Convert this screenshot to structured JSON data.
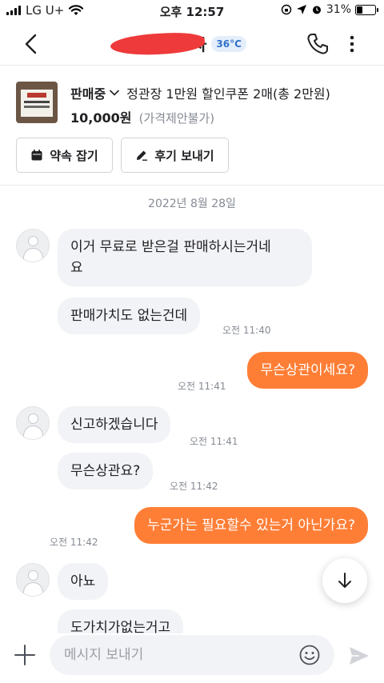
{
  "status_bar": {
    "carrier": "LG U+",
    "time": "오후 12:57",
    "battery": "31%",
    "battery_level": 0.31
  },
  "header": {
    "nickname_visible": "사",
    "temperature": "36°C"
  },
  "product": {
    "status": "판매중",
    "title": "정관장 1만원 할인쿠폰 2매(총 2만원)",
    "price": "10,000원",
    "price_note": "(가격제안불가)",
    "buttons": {
      "promise": "약속 잡기",
      "review": "후기 보내기"
    }
  },
  "chat": {
    "date": "2022년 8월 28일",
    "messages": [
      {
        "from": "them",
        "text": "이거 무료로 받은걸 판매하시는거네",
        "text2": "요"
      },
      {
        "from": "them",
        "text": "판매가치도 없는건데",
        "time": "오전 11:40"
      },
      {
        "from": "me",
        "text": "무슨상관이세요?",
        "time": "오전 11:41"
      },
      {
        "from": "them",
        "text": "신고하겠습니다",
        "time": "오전 11:41"
      },
      {
        "from": "them",
        "text": "무슨상관요?",
        "time": "오전 11:42"
      },
      {
        "from": "me",
        "text": "누군가는 필요할수 있는거 아닌가요?",
        "time": "오전 11:42"
      },
      {
        "from": "them",
        "text": "아뇨"
      },
      {
        "from": "them",
        "text": "도가치가없는거고"
      }
    ]
  },
  "input": {
    "placeholder": "메시지 보내기"
  },
  "colors": {
    "accent": "#ff7e36",
    "incoming_bubble": "#f2f3f6",
    "temp_badge": "#3171c8",
    "redaction": "#ee3a3a"
  },
  "icons": [
    "back-arrow-icon",
    "phone-icon",
    "more-icon",
    "chevron-down-icon",
    "calendar-icon",
    "pencil-icon",
    "arrow-down-icon",
    "plus-icon",
    "emoji-icon",
    "send-icon",
    "wifi-icon",
    "alarm-icon",
    "location-icon",
    "lock-rotation-icon"
  ]
}
